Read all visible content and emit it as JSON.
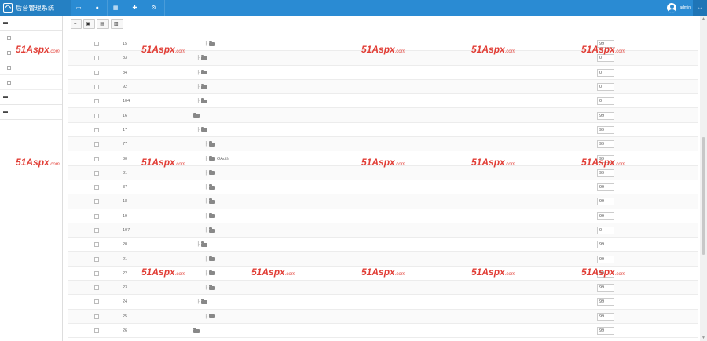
{
  "header": {
    "title": "后台管理系统",
    "nav": [
      {
        "icon": "monitor-icon",
        "label": ""
      },
      {
        "icon": "user-icon",
        "label": ""
      },
      {
        "icon": "grid-icon",
        "label": ""
      },
      {
        "icon": "puzzle-icon",
        "label": ""
      },
      {
        "icon": "gear-icon",
        "label": ""
      }
    ],
    "user": {
      "line1": "admin",
      "line2": ""
    }
  },
  "sidebar": {
    "groups": [
      {
        "label": "",
        "items": [
          {
            "label": ""
          },
          {
            "label": "",
            "active": true
          },
          {
            "label": ""
          },
          {
            "label": ""
          }
        ]
      },
      {
        "label": "",
        "items": []
      },
      {
        "label": "",
        "items": []
      }
    ]
  },
  "toolbar": {
    "buttons": [
      {
        "icon": "plus-icon",
        "label": ""
      },
      {
        "icon": "save-icon",
        "label": ""
      },
      {
        "icon": "sync-icon",
        "label": ""
      },
      {
        "icon": "trash-icon",
        "label": ""
      }
    ]
  },
  "menu_rows": [
    {
      "id": "15",
      "depth": 3,
      "name": "",
      "flag": "",
      "type": "",
      "sort": "99",
      "actions": [
        "",
        ""
      ]
    },
    {
      "id": "83",
      "depth": 2,
      "name": "",
      "flag": "",
      "type": "",
      "sort": "0",
      "actions": [
        "",
        ""
      ]
    },
    {
      "id": "84",
      "depth": 2,
      "name": "",
      "flag": "",
      "type": "",
      "sort": "0",
      "actions": [
        "",
        ""
      ]
    },
    {
      "id": "92",
      "depth": 2,
      "name": "",
      "flag": "",
      "type": "",
      "sort": "0",
      "actions": [
        "",
        ""
      ]
    },
    {
      "id": "104",
      "depth": 2,
      "name": "",
      "flag": "",
      "type": "",
      "sort": "0",
      "actions": [
        "",
        ""
      ]
    },
    {
      "id": "16",
      "depth": 1,
      "name": "",
      "flag": "",
      "type": "",
      "sort": "99",
      "actions": [
        "",
        ""
      ]
    },
    {
      "id": "17",
      "depth": 2,
      "name": "",
      "flag": "",
      "type": "",
      "sort": "99",
      "actions": [
        "",
        ""
      ]
    },
    {
      "id": "77",
      "depth": 3,
      "name": "",
      "flag": "",
      "type": "",
      "sort": "99",
      "actions": [
        "",
        ""
      ]
    },
    {
      "id": "30",
      "depth": 3,
      "name": "OAuth",
      "flag": "",
      "type": "",
      "sort": "99",
      "actions": [
        "",
        ""
      ]
    },
    {
      "id": "31",
      "depth": 3,
      "name": "",
      "flag": "",
      "type": "",
      "sort": "99",
      "actions": [
        "",
        ""
      ]
    },
    {
      "id": "37",
      "depth": 3,
      "name": "",
      "flag": "",
      "type": "",
      "sort": "99",
      "actions": [
        "",
        ""
      ]
    },
    {
      "id": "18",
      "depth": 3,
      "name": "",
      "flag": "",
      "type": "",
      "sort": "99",
      "actions": [
        "",
        ""
      ]
    },
    {
      "id": "19",
      "depth": 3,
      "name": "",
      "flag": "",
      "type": "",
      "sort": "99",
      "actions": [
        "",
        ""
      ]
    },
    {
      "id": "107",
      "depth": 3,
      "name": "",
      "flag": "",
      "type": "",
      "sort": "0",
      "actions": [
        "",
        ""
      ]
    },
    {
      "id": "20",
      "depth": 2,
      "name": "",
      "flag": "",
      "type": "",
      "sort": "99",
      "actions": [
        "",
        ""
      ]
    },
    {
      "id": "21",
      "depth": 3,
      "name": "",
      "flag": "",
      "type": "",
      "sort": "99",
      "actions": [
        "",
        ""
      ]
    },
    {
      "id": "22",
      "depth": 3,
      "name": "",
      "flag": "",
      "type": "",
      "sort": "99",
      "actions": [
        "",
        ""
      ]
    },
    {
      "id": "23",
      "depth": 3,
      "name": "",
      "flag": "",
      "type": "",
      "sort": "99",
      "actions": [
        "",
        ""
      ]
    },
    {
      "id": "24",
      "depth": 2,
      "name": "",
      "flag": "",
      "type": "",
      "sort": "99",
      "actions": [
        "",
        ""
      ]
    },
    {
      "id": "25",
      "depth": 3,
      "name": "",
      "flag": "",
      "type": "",
      "sort": "99",
      "actions": [
        "",
        ""
      ]
    },
    {
      "id": "26",
      "depth": 1,
      "name": "",
      "flag": "",
      "type": "",
      "sort": "99",
      "actions": [
        "",
        ""
      ]
    }
  ],
  "watermark": {
    "text": "51Aspx",
    "suffix": ".com"
  },
  "colors": {
    "header": "#2a8bd3",
    "link": "#2a8bd3",
    "watermark": "#e0342c"
  }
}
